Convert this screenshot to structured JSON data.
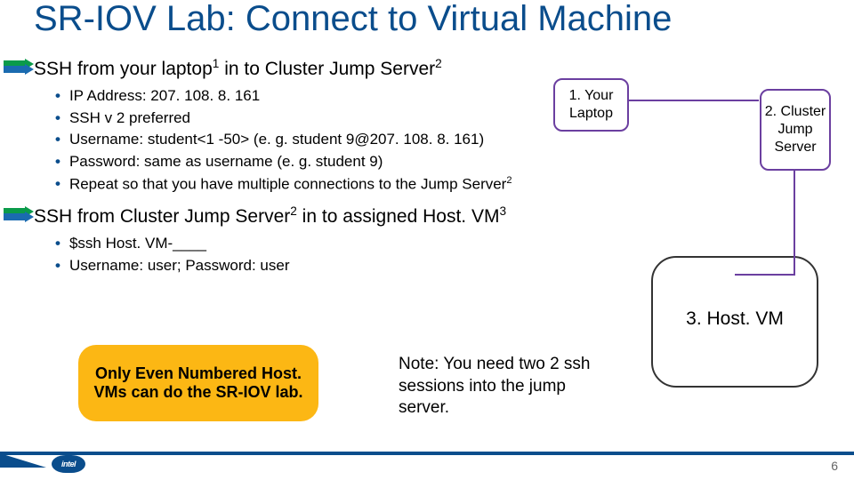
{
  "title": "SR-IOV Lab: Connect to Virtual Machine",
  "step1": {
    "heading_pre": "SSH from your laptop",
    "heading_sup1": "1",
    "heading_mid": " in to Cluster Jump Server",
    "heading_sup2": "2",
    "bullets": [
      "IP Address: 207. 108. 8. 161",
      "SSH v 2 preferred",
      "Username: student<1 -50> (e. g. student 9@207. 108. 8. 161)",
      "Password: same as username (e. g. student 9)"
    ],
    "bullet_repeat_pre": "Repeat so that you have multiple connections to the Jump Server",
    "bullet_repeat_sup": "2"
  },
  "step2": {
    "heading_pre": "SSH from Cluster Jump Server",
    "heading_sup1": "2",
    "heading_mid": " in to assigned Host. VM",
    "heading_sup2": "3",
    "bullets": [
      "$ssh Host. VM-____",
      "Username: user; Password: user"
    ]
  },
  "callout_even": "Only Even Numbered Host. VMs can do the SR-IOV lab.",
  "note": "Note: You need two 2 ssh sessions into the jump server.",
  "boxes": {
    "laptop": "1. Your Laptop",
    "cluster": "2. Cluster Jump Server",
    "hostvm": "3. Host. VM"
  },
  "logo_text": "intel",
  "page_number": "6"
}
